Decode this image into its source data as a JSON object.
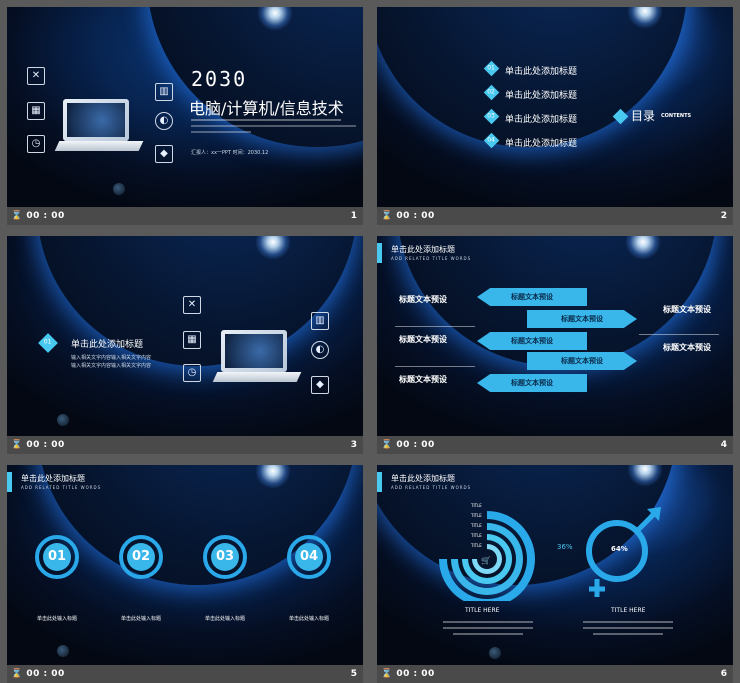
{
  "slides": [
    {
      "time": "00 : 00",
      "number": "1",
      "year": "2030",
      "title": "电脑/计算机/信息技术",
      "byline": "汇报人：xx一PPT     时间：2030.12"
    },
    {
      "time": "00 : 00",
      "number": "2",
      "items": [
        "单击此处添加标题",
        "单击此处添加标题",
        "单击此处添加标题",
        "单击此处添加标题"
      ],
      "toc": "目录",
      "toc_en": "CONTENTS"
    },
    {
      "time": "00 : 00",
      "number": "3",
      "badge": "01",
      "title": "单击此处添加标题",
      "lines": [
        "输入相关文字内容",
        "输入相关文字内容",
        "输入相关文字内容",
        "输入相关文字内容"
      ]
    },
    {
      "time": "00 : 00",
      "number": "4",
      "header": "单击此处添加标题",
      "sub": "ADD RELATED TITLE WORDS",
      "left_titles": [
        "标题文本预设",
        "标题文本预设",
        "标题文本预设"
      ],
      "right_titles": [
        "标题文本预设",
        "标题文本预设"
      ],
      "arrows": [
        "标题文本预设",
        "标题文本预设",
        "标题文本预设",
        "标题文本预设",
        "标题文本预设"
      ]
    },
    {
      "time": "00 : 00",
      "number": "5",
      "header": "单击此处添加标题",
      "sub": "ADD RELATED TITLE WORDS",
      "rings": [
        "01",
        "02",
        "03",
        "04"
      ],
      "captions": [
        "单击此处输入标题",
        "单击此处输入标题",
        "单击此处输入标题",
        "单击此处输入标题"
      ]
    },
    {
      "time": "00 : 00",
      "number": "6",
      "header": "单击此处添加标题",
      "sub": "ADD RELATED TITLE WORDS",
      "title_labels": [
        "TITLE",
        "TITLE",
        "TITLE",
        "TITLE",
        "TITLE"
      ],
      "pct_left": "36%",
      "pct_right": "64%",
      "heading_left": "TITLE HERE",
      "heading_right": "TITLE HERE"
    }
  ],
  "colors": {
    "accent": "#49c8f0",
    "bar": "#4a4a4a",
    "bg": "#5a5a5a"
  }
}
